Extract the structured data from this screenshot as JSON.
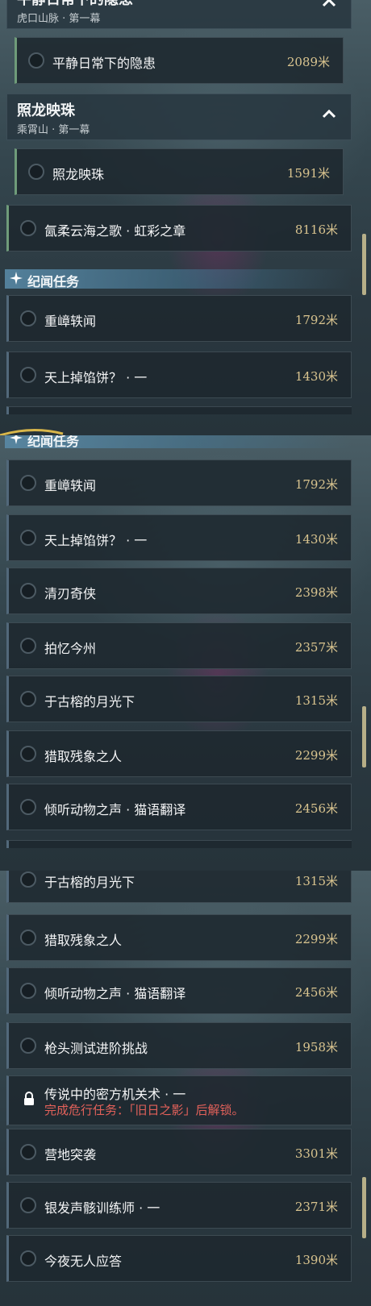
{
  "panel1": {
    "top_group": {
      "title": "平静日常下的隐患",
      "subtitle": "虎口山脉 · 第一幕"
    },
    "top_sub_quest": {
      "name": "平静日常下的隐患",
      "distance": "2089米"
    },
    "group2": {
      "title": "照龙映珠",
      "subtitle": "乘霄山 · 第一幕"
    },
    "group2_sub_quest": {
      "name": "照龙映珠",
      "distance": "1591米"
    },
    "quest_rainbow": {
      "name": "氤柔云海之歌 · 虹彩之章",
      "distance": "8116米"
    },
    "section_title": "纪闻任务",
    "quests": [
      {
        "name": "重嶂轶闻",
        "distance": "1792米"
      },
      {
        "name": "天上掉馅饼？ · 一",
        "distance": "1430米"
      }
    ]
  },
  "panel2": {
    "section_title": "纪闻任务",
    "quests": [
      {
        "name": "重嶂轶闻",
        "distance": "1792米"
      },
      {
        "name": "天上掉馅饼？ · 一",
        "distance": "1430米"
      },
      {
        "name": "清刃奇侠",
        "distance": "2398米"
      },
      {
        "name": "拍忆今州",
        "distance": "2357米"
      },
      {
        "name": "于古榕的月光下",
        "distance": "1315米"
      },
      {
        "name": "猎取残象之人",
        "distance": "2299米"
      },
      {
        "name": "倾听动物之声 · 猫语翻译",
        "distance": "2456米"
      }
    ]
  },
  "panel3": {
    "quests": [
      {
        "name": "于古榕的月光下",
        "distance": "1315米"
      },
      {
        "name": "猎取残象之人",
        "distance": "2299米"
      },
      {
        "name": "倾听动物之声 · 猫语翻译",
        "distance": "2456米"
      },
      {
        "name": "枪头测试进阶挑战",
        "distance": "1958米"
      }
    ],
    "locked_quest": {
      "name": "传说中的密方机关术 · 一",
      "note": "完成危行任务：「旧日之影」后解锁。"
    },
    "quests_after": [
      {
        "name": "营地突袭",
        "distance": "3301米"
      },
      {
        "name": "银发声骸训练师 · 一",
        "distance": "2371米"
      },
      {
        "name": "今夜无人应答",
        "distance": "1390米"
      }
    ]
  },
  "colors": {
    "distance_gold": "#d9c48f",
    "locked_red": "#e3615a",
    "section_blue": "#5a8caa",
    "scrollbar": "#e6d7a0"
  },
  "icons": [
    "chevron-up-icon",
    "star-icon",
    "lock-icon",
    "status-circle-icon"
  ]
}
